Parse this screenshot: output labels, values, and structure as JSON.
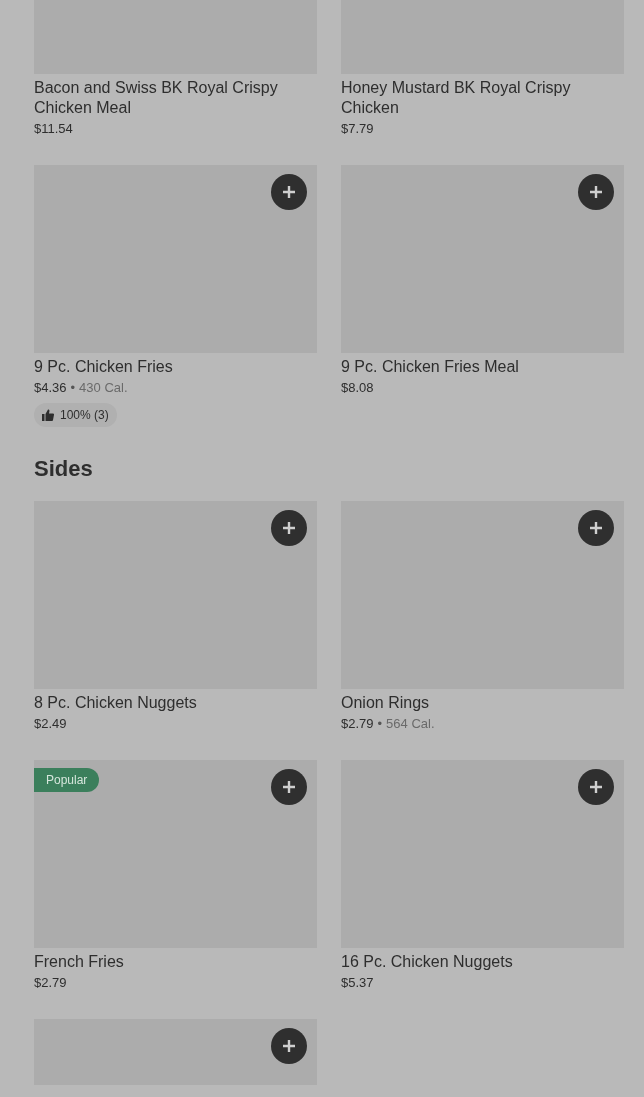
{
  "sections": [
    {
      "items": [
        {
          "name": "Bacon and Swiss BK Royal Crispy Chicken Meal",
          "price": "$11.54",
          "add_button": false
        },
        {
          "name": "Honey Mustard BK Royal Crispy Chicken",
          "price": "$7.79",
          "add_button": false
        },
        {
          "name": "9 Pc. Chicken Fries",
          "price": "$4.36",
          "separator": "•",
          "calories": "430 Cal.",
          "rating": "100% (3)",
          "add_button": true
        },
        {
          "name": "9 Pc. Chicken Fries Meal",
          "price": "$8.08",
          "add_button": true
        }
      ]
    },
    {
      "title": "Sides",
      "items": [
        {
          "name": "8 Pc. Chicken Nuggets",
          "price": "$2.49",
          "add_button": true
        },
        {
          "name": "Onion Rings",
          "price": "$2.79",
          "separator": "•",
          "calories": "564 Cal.",
          "add_button": true
        },
        {
          "name": "French Fries",
          "price": "$2.79",
          "badge": "Popular",
          "add_button": true
        },
        {
          "name": "16 Pc. Chicken Nuggets",
          "price": "$5.37",
          "add_button": true
        },
        {
          "add_button": true
        }
      ]
    }
  ]
}
